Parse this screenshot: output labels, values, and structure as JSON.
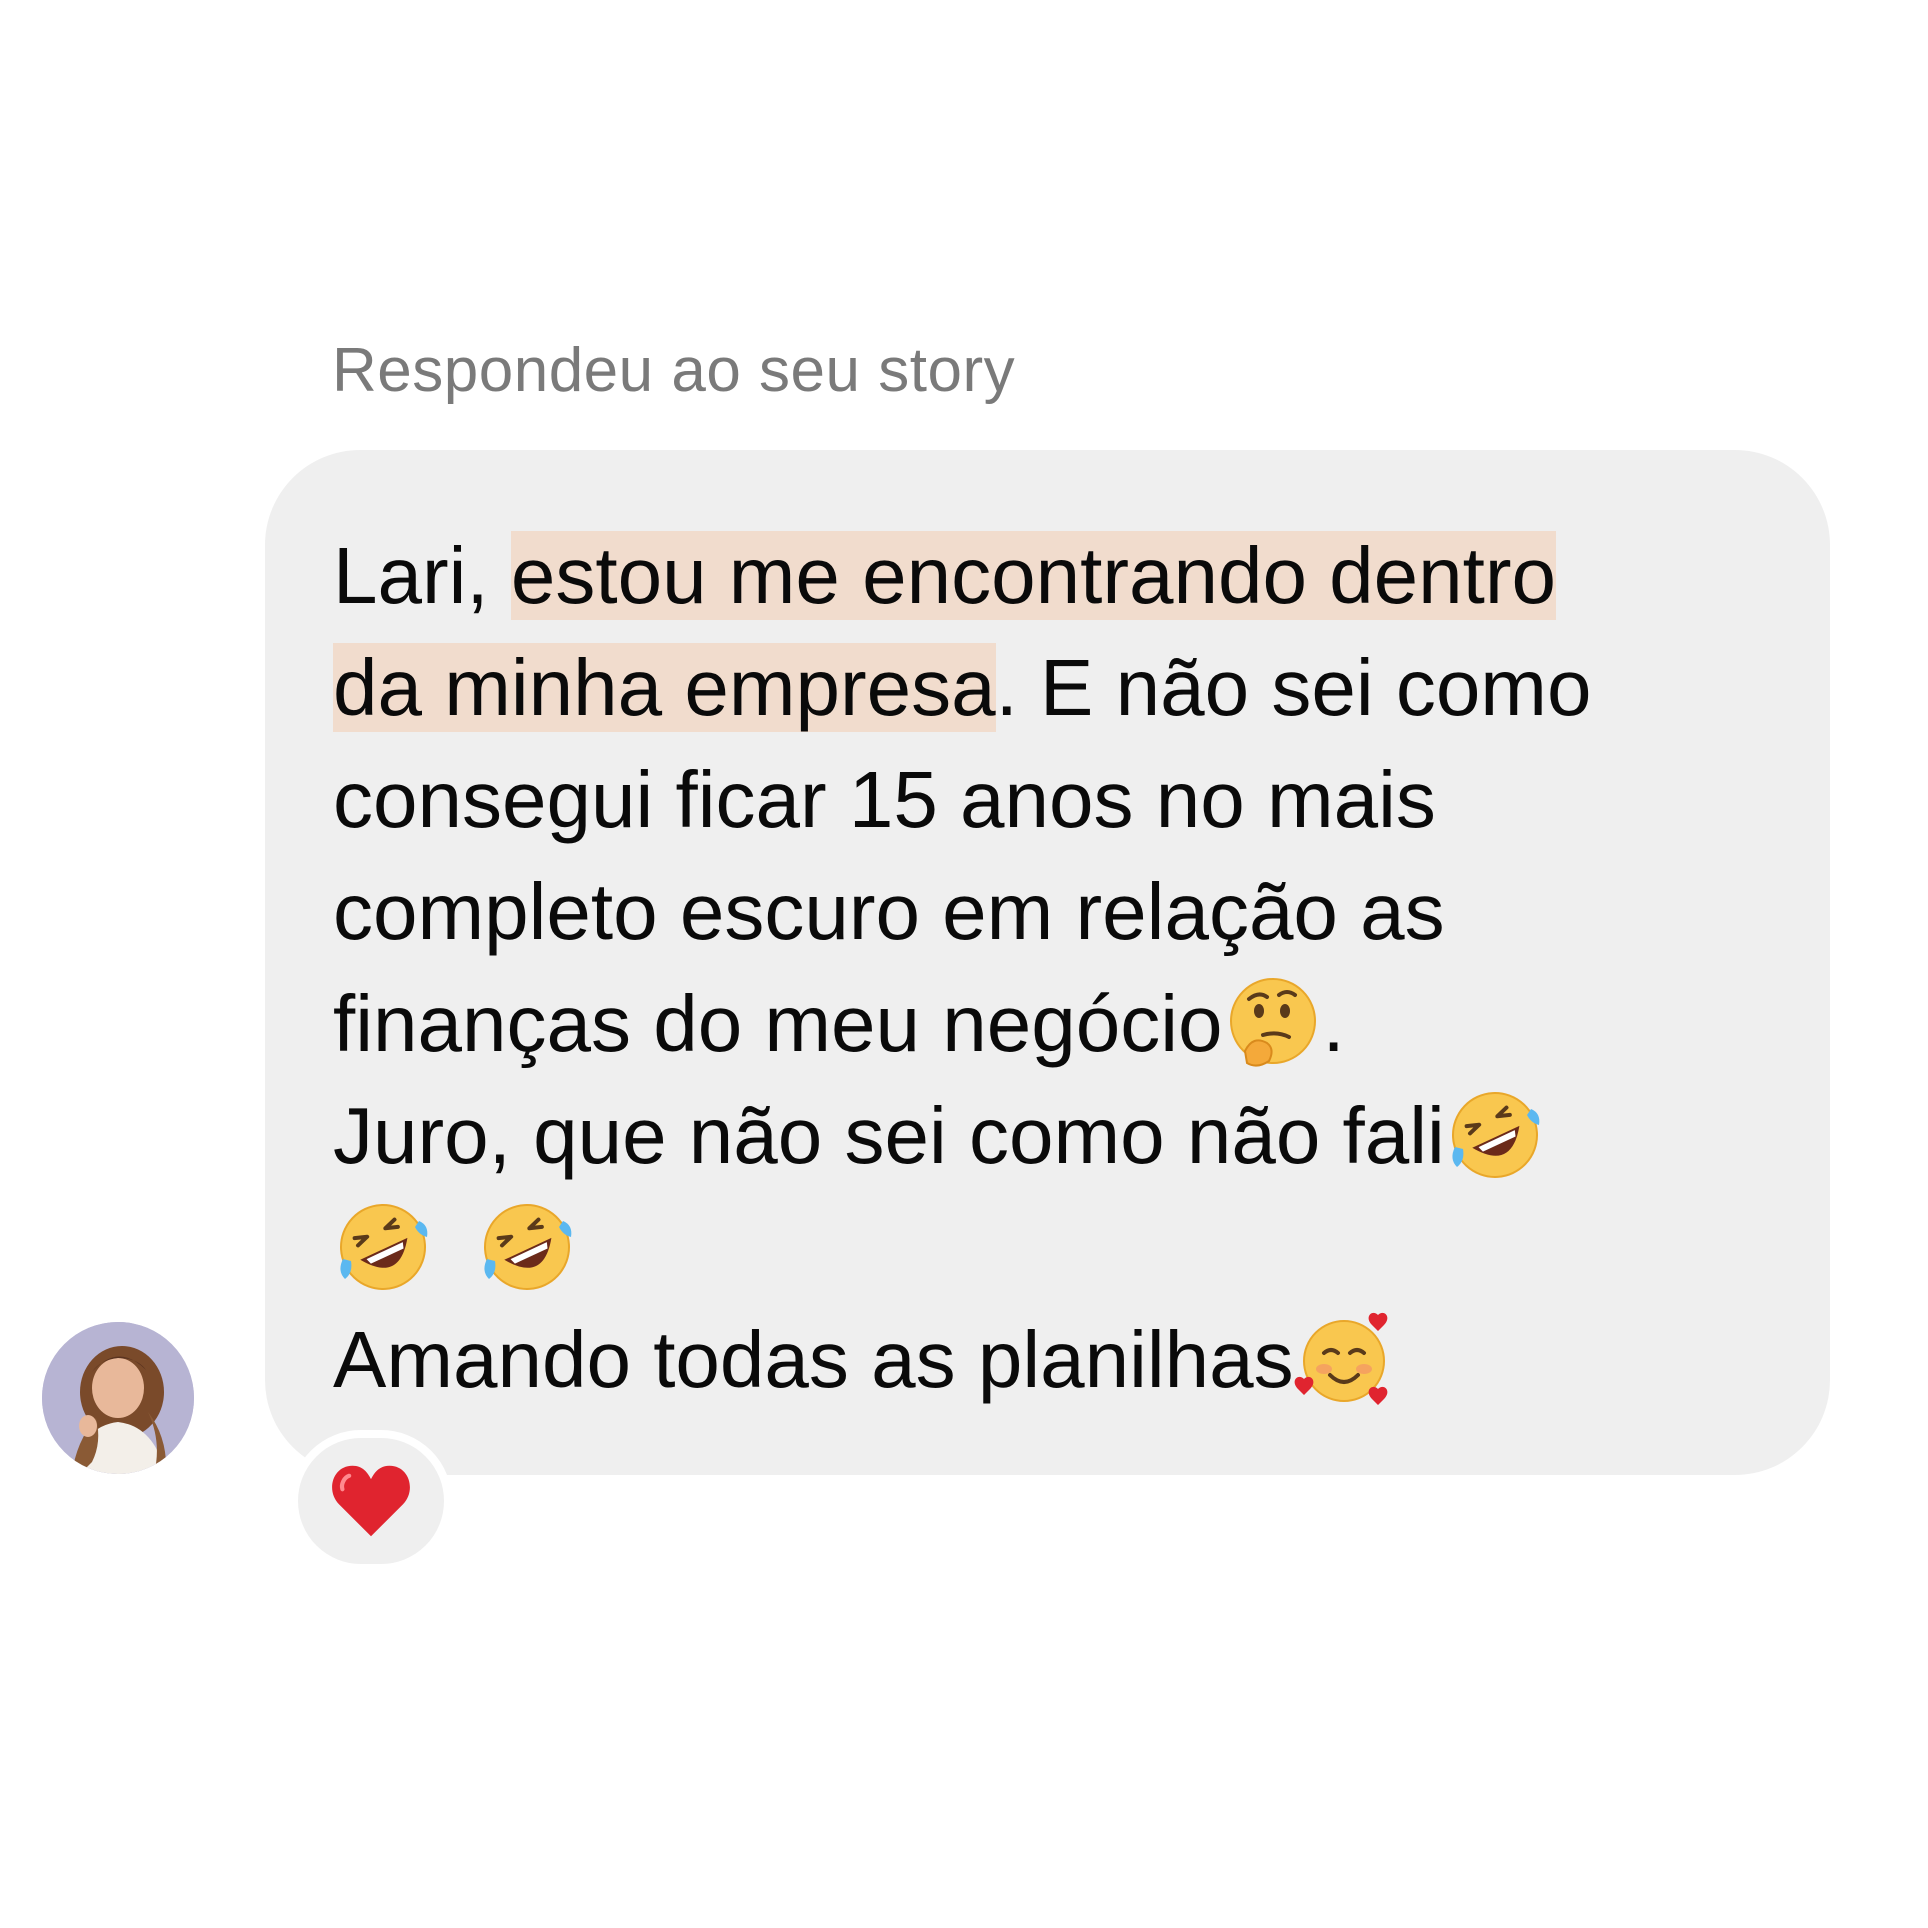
{
  "story_reply": {
    "label": "Respondeu ao seu story"
  },
  "message": {
    "line1_before": "Lari, ",
    "line1_highlight": "estou me encontrando dentro",
    "line2_highlight": "da minha empresa",
    "line2_after": ". E não sei como",
    "line3": "consegui ficar 15 anos no mais",
    "line4": "completo escuro em relação as",
    "line5_text": "finanças do meu negócio",
    "line5_emoji": "thinking-face",
    "line5_after": ".",
    "line6_text": "Juro, que não sei como não fali",
    "line6_emoji": "rolling-on-floor-laughing",
    "line7_emojis": [
      "rolling-on-floor-laughing",
      "rolling-on-floor-laughing"
    ],
    "line8_text": "Amando todas as planilhas",
    "line8_emoji": "smiling-face-with-hearts"
  },
  "reaction": {
    "emoji": "red-heart"
  },
  "colors": {
    "bubble_bg": "#efefef",
    "highlight": "#f1dccd",
    "label_text": "#7a7a7a",
    "message_text": "#0a0a0a"
  }
}
